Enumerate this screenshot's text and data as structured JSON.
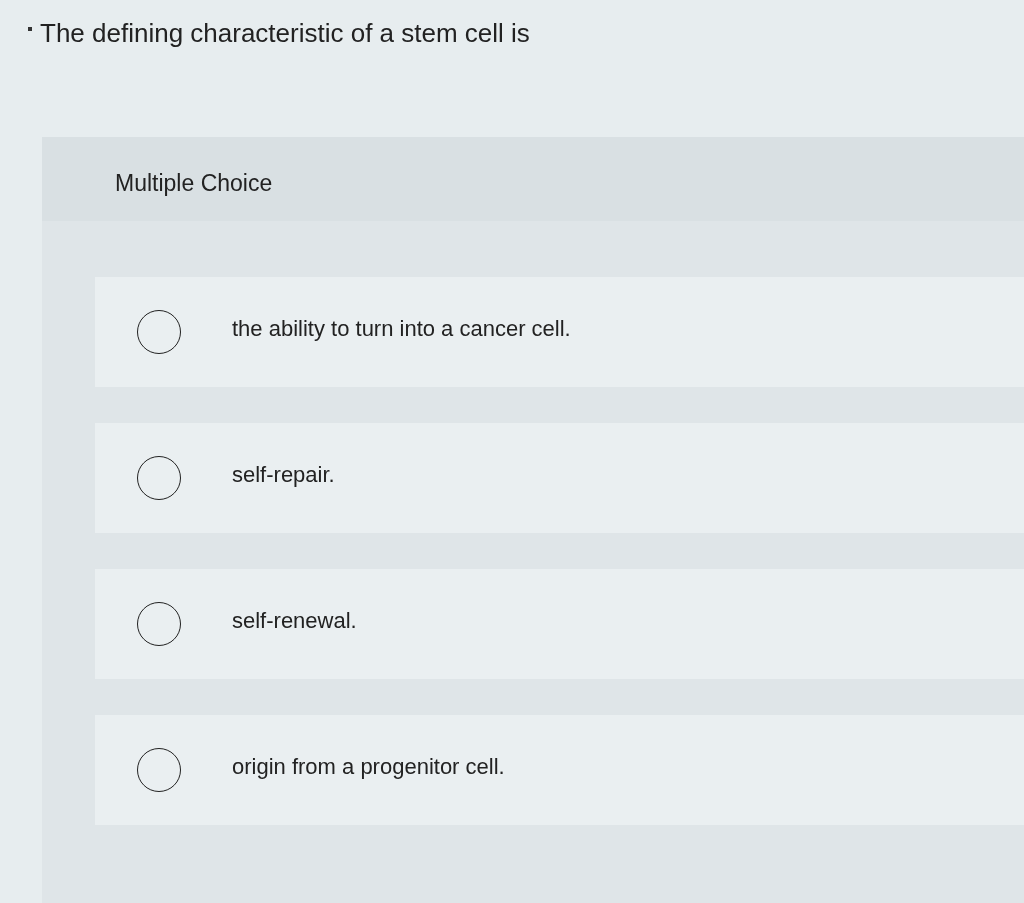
{
  "question": {
    "text": "The defining characteristic of a stem cell is"
  },
  "question_type": "Multiple Choice",
  "options": [
    {
      "label": "the ability to turn into a cancer cell.",
      "selected": false
    },
    {
      "label": "self-repair.",
      "selected": false
    },
    {
      "label": "self-renewal.",
      "selected": false
    },
    {
      "label": "origin from a progenitor cell.",
      "selected": false
    }
  ]
}
